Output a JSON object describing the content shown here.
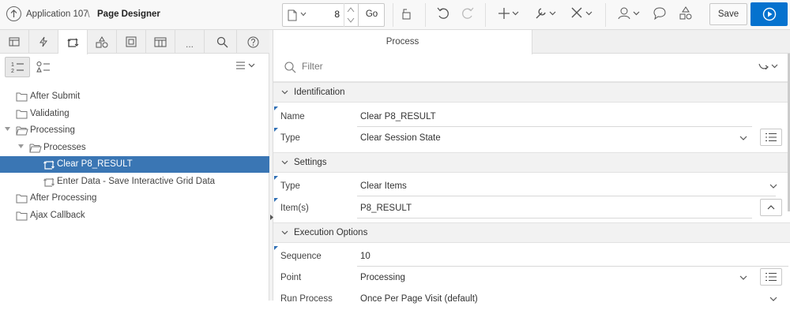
{
  "header": {
    "app_label": "Application 107",
    "separator": "\\",
    "page_label": "Page Designer",
    "page_number": "8",
    "go_label": "Go",
    "save_label": "Save",
    "run_color": "#0572ce"
  },
  "left_tabs": [
    {
      "icon": "rendering-icon"
    },
    {
      "icon": "dynamic-actions-icon"
    },
    {
      "icon": "processing-icon",
      "active": true
    },
    {
      "icon": "shared-components-icon"
    },
    {
      "icon": "gallery-icon"
    },
    {
      "icon": "component-view-icon"
    },
    {
      "label": "..."
    },
    {
      "icon": "search-icon"
    },
    {
      "icon": "help-icon"
    }
  ],
  "tree": [
    {
      "label": "After Submit",
      "indent": 0,
      "type": "folder"
    },
    {
      "label": "Validating",
      "indent": 0,
      "type": "folder"
    },
    {
      "label": "Processing",
      "indent": 0,
      "type": "folder-open",
      "expanded": true
    },
    {
      "label": "Processes",
      "indent": 1,
      "type": "folder-open",
      "expanded": true
    },
    {
      "label": "Clear P8_RESULT",
      "indent": 2,
      "type": "process",
      "selected": true
    },
    {
      "label": "Enter Data - Save Interactive Grid Data",
      "indent": 2,
      "type": "process"
    },
    {
      "label": "After Processing",
      "indent": 0,
      "type": "folder"
    },
    {
      "label": "Ajax Callback",
      "indent": 0,
      "type": "folder"
    }
  ],
  "right": {
    "tab_label": "Process",
    "filter_placeholder": "Filter",
    "sections": {
      "identification": "Identification",
      "settings": "Settings",
      "execution": "Execution Options"
    },
    "props": {
      "name": {
        "label": "Name",
        "value": "Clear P8_RESULT"
      },
      "type": {
        "label": "Type",
        "value": "Clear Session State"
      },
      "settings_type": {
        "label": "Type",
        "value": "Clear Items"
      },
      "items": {
        "label": "Item(s)",
        "value": "P8_RESULT"
      },
      "sequence": {
        "label": "Sequence",
        "value": "10"
      },
      "point": {
        "label": "Point",
        "value": "Processing"
      },
      "run_process": {
        "label": "Run Process",
        "value": "Once Per Page Visit (default)"
      }
    }
  }
}
